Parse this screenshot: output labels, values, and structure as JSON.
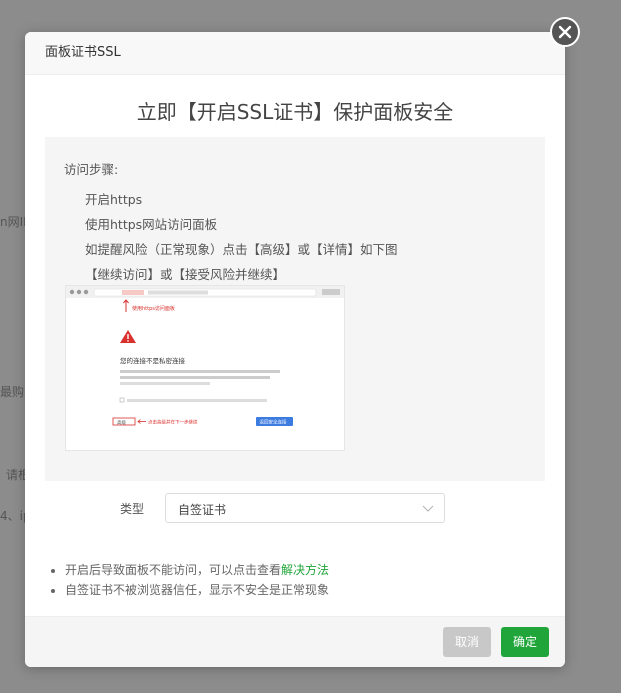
{
  "backdrop": {
    "fragment_1": "n网IP",
    "fragment_2": "最购买",
    "fragment_3": "请根",
    "fragment_4": "4、ip"
  },
  "modal": {
    "title": "面板证书SSL",
    "headline": "立即【开启SSL证书】保护面板安全",
    "guide": {
      "title": "访问步骤:",
      "steps": [
        "开启https",
        "使用https网站访问面板",
        "如提醒风险（正常现象）点击【高级】或【详情】如下图",
        "【继续访问】或【接受风险并继续】"
      ]
    },
    "browser_screenshot": {
      "warning_heading": "您的连接不是私密连接",
      "annotation_top": "使用https访问面板",
      "annotation_advanced": "点击高级并在下一步继续",
      "advanced_button": "高级",
      "primary_button": "返回安全连接"
    },
    "type_field": {
      "label": "类型",
      "value": "自签证书"
    },
    "notes": {
      "item1_prefix": "开启后导致面板不能访问，可以点击查看",
      "item1_link": "解决方法",
      "item2": "自签证书不被浏览器信任，显示不安全是正常现象"
    },
    "buttons": {
      "cancel": "取消",
      "confirm": "确定"
    }
  },
  "colors": {
    "accent": "#20a53a",
    "overlay": "#8c8c8c",
    "warning_red": "#d9302c",
    "link_blue": "#3c7be0"
  },
  "icons": {
    "close": "close-icon",
    "select_arrow": "chevron-down-icon",
    "warning": "warning-triangle-icon"
  }
}
